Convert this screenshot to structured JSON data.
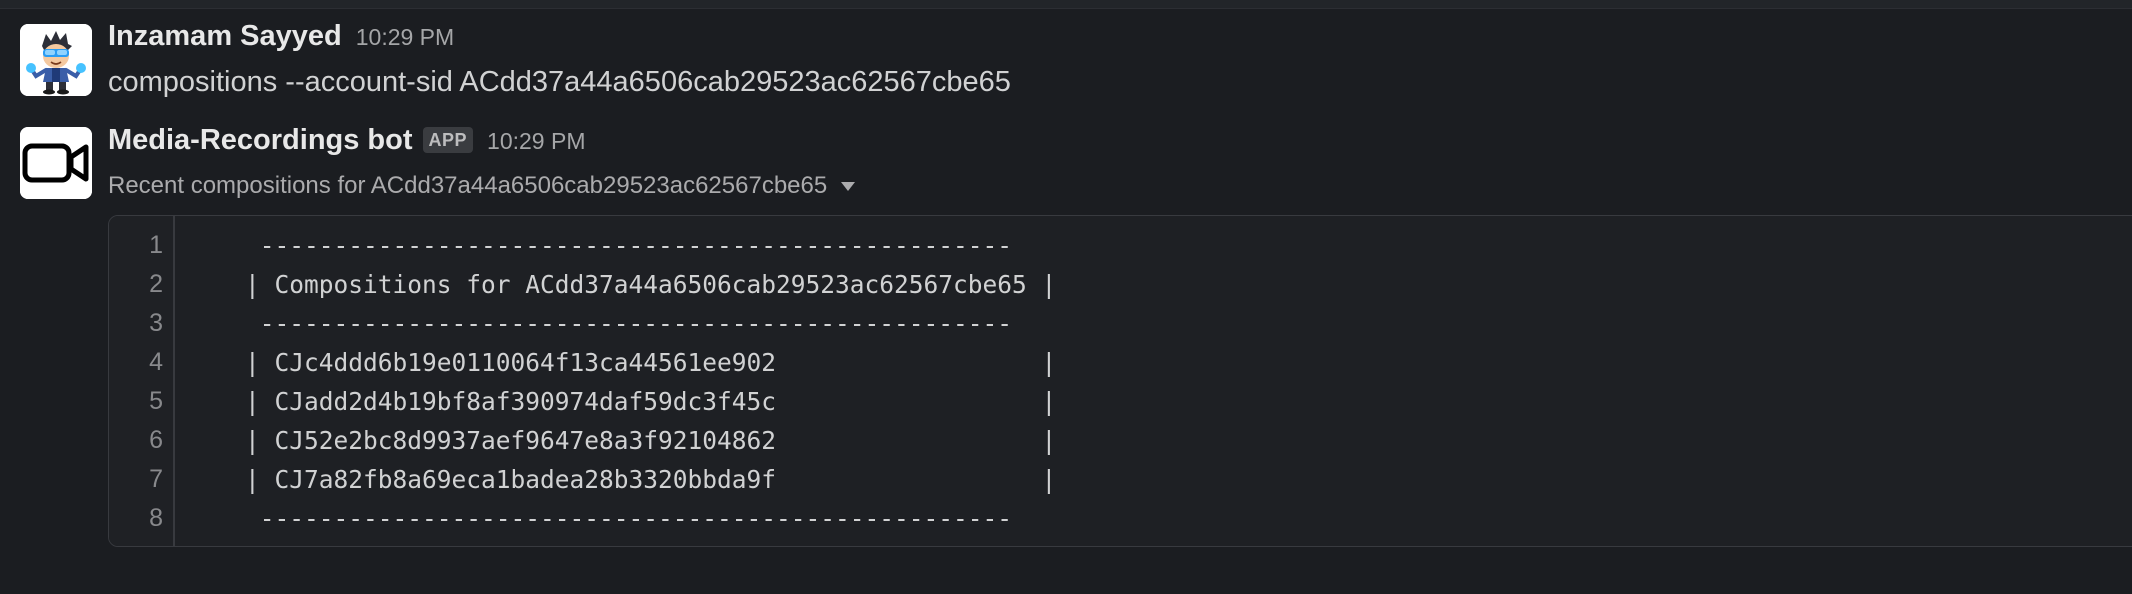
{
  "messages": [
    {
      "sender": "Inzamam Sayyed",
      "time": "10:29 PM",
      "avatar_icon": "cartoon-avatar-icon",
      "text": "compositions --account-sid ACdd37a44a6506cab29523ac62567cbe65"
    },
    {
      "sender": "Media-Recordings bot",
      "badge": "APP",
      "time": "10:29 PM",
      "avatar_icon": "video-camera-icon",
      "subtitle": "Recent compositions for ACdd37a44a6506cab29523ac62567cbe65",
      "code": {
        "line_numbers": [
          "1",
          "2",
          "3",
          "4",
          "5",
          "6",
          "7",
          "8"
        ],
        "lines": [
          " ---------------------------------------------------",
          "| Compositions for ACdd37a44a6506cab29523ac62567cbe65 |",
          " ---------------------------------------------------",
          "| CJc4ddd6b19e0110064f13ca44561ee902                  |",
          "| CJadd2d4b19bf8af390974daf59dc3f45c                  |",
          "| CJ52e2bc8d9937aef9647e8a3f92104862                  |",
          "| CJ7a82fb8a69eca1badea28b3320bbda9f                  |",
          " ---------------------------------------------------"
        ]
      }
    }
  ],
  "colors": {
    "background": "#1b1d21",
    "text": "#d1d2d3",
    "muted": "#ababad",
    "code_background": "#1e2024",
    "border": "#383a3f"
  }
}
